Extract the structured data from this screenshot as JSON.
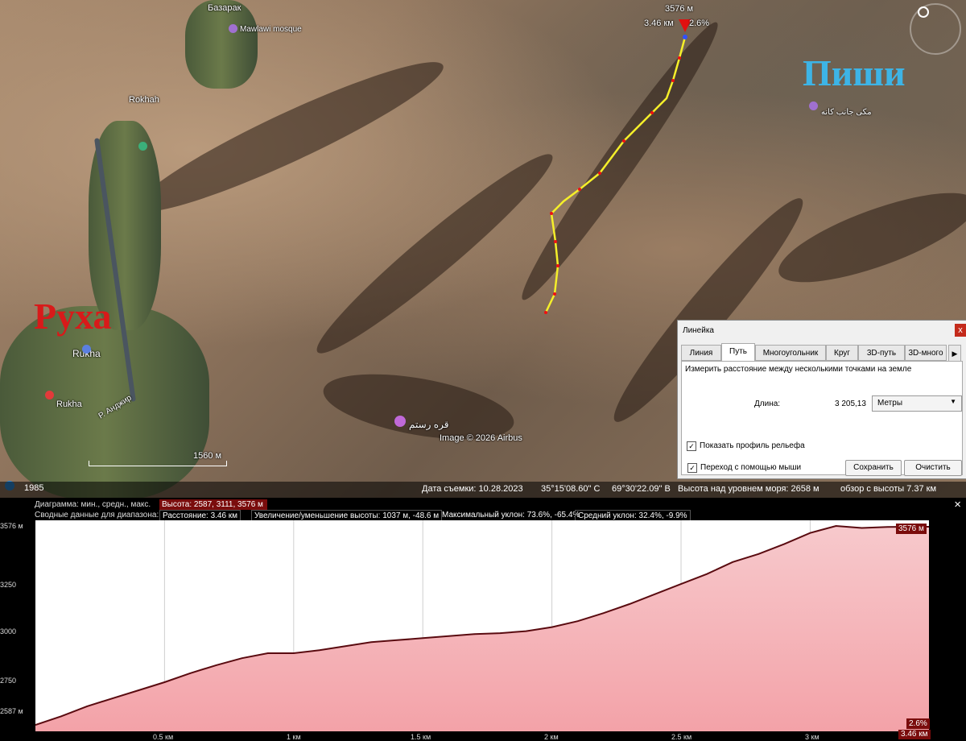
{
  "map": {
    "labels": {
      "bazar": "Базарак",
      "rokhah": "Rokhah",
      "rukha": "Rukha",
      "rukha2": "Rukha",
      "mosque1": "Mawlawi mosque",
      "mosque2": "قره رستم",
      "shrine": "مکی جانب کانه",
      "river": "Р. Анджир",
      "scale": "1560 м",
      "copyright": "Image © 2026 Airbus"
    },
    "big_red_label": "Руха",
    "big_blue_label": "Пиши",
    "track_point": {
      "elevation": "3576 м",
      "distance": "3.46 км",
      "slope": "2.6%"
    },
    "history_year": "1985"
  },
  "statusbar": {
    "date": "Дата съемки: 10.28.2023",
    "lat": "35°15'08.60\" С",
    "lon": "69°30'22.09\" В",
    "elevation": "Высота над уровнем моря:  2658 м",
    "eye": "обзор с высоты  7.37 км"
  },
  "ruler": {
    "title": "Линейка",
    "close": "x",
    "tabs": [
      "Линия",
      "Путь",
      "Многоугольник",
      "Круг",
      "3D-путь",
      "3D-много"
    ],
    "active_tab": "Путь",
    "description": "Измерить расстояние между несколькими точками на земле",
    "length_label": "Длина:",
    "length_value": "3 205,13",
    "unit": "Метры",
    "show_profile": "Показать профиль рельефа",
    "mouse_nav": "Переход с помощью мыши",
    "save": "Сохранить",
    "clear": "Очистить"
  },
  "profile": {
    "diagram_label": "Диаграмма: мин., средн., макс.",
    "height_values": "Высота: 2587, 3111, 3576 м",
    "summary_label": "Сводные данные для диапазона:",
    "distance": "Расстояние: 3.46 км",
    "gain_loss": "Увеличение/уменьшение высоты: 1037 м, -48.6 м",
    "max_slope": "Максимальный уклон: 73.6%, -65.4%",
    "avg_slope": "Средний уклон: 32.4%, -9.9%",
    "close": "×",
    "max_tag": "3576 м",
    "slope_tag": "2.6%",
    "dist_tag": "3.46 км"
  },
  "chart_data": {
    "type": "area",
    "xlabel": "",
    "ylabel": "",
    "x_ticks": [
      "0.5 км",
      "1 км",
      "1.5 км",
      "2 км",
      "2.5 км",
      "3 км"
    ],
    "y_ticks": [
      "3576 м",
      "3250",
      "3000",
      "2750",
      "2587 м"
    ],
    "xlim": [
      0,
      3.46
    ],
    "ylim": [
      2587,
      3576
    ],
    "x": [
      0,
      0.1,
      0.2,
      0.3,
      0.4,
      0.5,
      0.6,
      0.7,
      0.8,
      0.9,
      1.0,
      1.1,
      1.2,
      1.3,
      1.4,
      1.5,
      1.6,
      1.7,
      1.8,
      1.9,
      2.0,
      2.1,
      2.2,
      2.3,
      2.4,
      2.5,
      2.6,
      2.7,
      2.8,
      2.9,
      3.0,
      3.1,
      3.2,
      3.3,
      3.4,
      3.46
    ],
    "y": [
      2587,
      2630,
      2680,
      2720,
      2760,
      2800,
      2845,
      2885,
      2920,
      2945,
      2945,
      2960,
      2980,
      3000,
      3010,
      3020,
      3030,
      3040,
      3045,
      3055,
      3075,
      3105,
      3145,
      3190,
      3240,
      3290,
      3340,
      3400,
      3440,
      3490,
      3545,
      3580,
      3570,
      3575,
      3576,
      3576
    ]
  }
}
